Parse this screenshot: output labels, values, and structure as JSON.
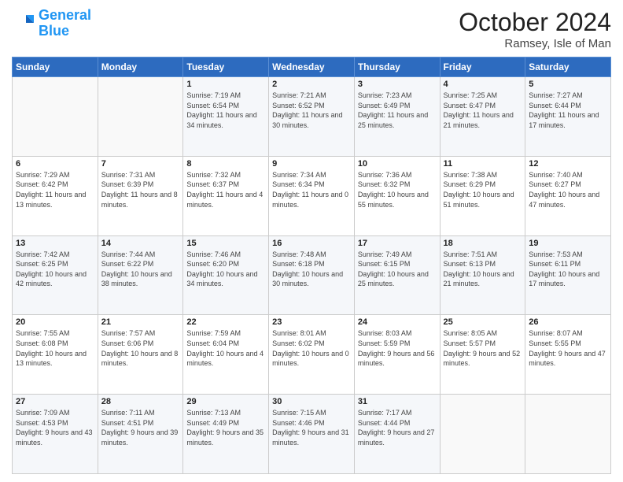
{
  "header": {
    "logo_line1": "General",
    "logo_line2": "Blue",
    "month": "October 2024",
    "location": "Ramsey, Isle of Man"
  },
  "weekdays": [
    "Sunday",
    "Monday",
    "Tuesday",
    "Wednesday",
    "Thursday",
    "Friday",
    "Saturday"
  ],
  "weeks": [
    [
      {
        "day": "",
        "sunrise": "",
        "sunset": "",
        "daylight": ""
      },
      {
        "day": "",
        "sunrise": "",
        "sunset": "",
        "daylight": ""
      },
      {
        "day": "1",
        "sunrise": "Sunrise: 7:19 AM",
        "sunset": "Sunset: 6:54 PM",
        "daylight": "Daylight: 11 hours and 34 minutes."
      },
      {
        "day": "2",
        "sunrise": "Sunrise: 7:21 AM",
        "sunset": "Sunset: 6:52 PM",
        "daylight": "Daylight: 11 hours and 30 minutes."
      },
      {
        "day": "3",
        "sunrise": "Sunrise: 7:23 AM",
        "sunset": "Sunset: 6:49 PM",
        "daylight": "Daylight: 11 hours and 25 minutes."
      },
      {
        "day": "4",
        "sunrise": "Sunrise: 7:25 AM",
        "sunset": "Sunset: 6:47 PM",
        "daylight": "Daylight: 11 hours and 21 minutes."
      },
      {
        "day": "5",
        "sunrise": "Sunrise: 7:27 AM",
        "sunset": "Sunset: 6:44 PM",
        "daylight": "Daylight: 11 hours and 17 minutes."
      }
    ],
    [
      {
        "day": "6",
        "sunrise": "Sunrise: 7:29 AM",
        "sunset": "Sunset: 6:42 PM",
        "daylight": "Daylight: 11 hours and 13 minutes."
      },
      {
        "day": "7",
        "sunrise": "Sunrise: 7:31 AM",
        "sunset": "Sunset: 6:39 PM",
        "daylight": "Daylight: 11 hours and 8 minutes."
      },
      {
        "day": "8",
        "sunrise": "Sunrise: 7:32 AM",
        "sunset": "Sunset: 6:37 PM",
        "daylight": "Daylight: 11 hours and 4 minutes."
      },
      {
        "day": "9",
        "sunrise": "Sunrise: 7:34 AM",
        "sunset": "Sunset: 6:34 PM",
        "daylight": "Daylight: 11 hours and 0 minutes."
      },
      {
        "day": "10",
        "sunrise": "Sunrise: 7:36 AM",
        "sunset": "Sunset: 6:32 PM",
        "daylight": "Daylight: 10 hours and 55 minutes."
      },
      {
        "day": "11",
        "sunrise": "Sunrise: 7:38 AM",
        "sunset": "Sunset: 6:29 PM",
        "daylight": "Daylight: 10 hours and 51 minutes."
      },
      {
        "day": "12",
        "sunrise": "Sunrise: 7:40 AM",
        "sunset": "Sunset: 6:27 PM",
        "daylight": "Daylight: 10 hours and 47 minutes."
      }
    ],
    [
      {
        "day": "13",
        "sunrise": "Sunrise: 7:42 AM",
        "sunset": "Sunset: 6:25 PM",
        "daylight": "Daylight: 10 hours and 42 minutes."
      },
      {
        "day": "14",
        "sunrise": "Sunrise: 7:44 AM",
        "sunset": "Sunset: 6:22 PM",
        "daylight": "Daylight: 10 hours and 38 minutes."
      },
      {
        "day": "15",
        "sunrise": "Sunrise: 7:46 AM",
        "sunset": "Sunset: 6:20 PM",
        "daylight": "Daylight: 10 hours and 34 minutes."
      },
      {
        "day": "16",
        "sunrise": "Sunrise: 7:48 AM",
        "sunset": "Sunset: 6:18 PM",
        "daylight": "Daylight: 10 hours and 30 minutes."
      },
      {
        "day": "17",
        "sunrise": "Sunrise: 7:49 AM",
        "sunset": "Sunset: 6:15 PM",
        "daylight": "Daylight: 10 hours and 25 minutes."
      },
      {
        "day": "18",
        "sunrise": "Sunrise: 7:51 AM",
        "sunset": "Sunset: 6:13 PM",
        "daylight": "Daylight: 10 hours and 21 minutes."
      },
      {
        "day": "19",
        "sunrise": "Sunrise: 7:53 AM",
        "sunset": "Sunset: 6:11 PM",
        "daylight": "Daylight: 10 hours and 17 minutes."
      }
    ],
    [
      {
        "day": "20",
        "sunrise": "Sunrise: 7:55 AM",
        "sunset": "Sunset: 6:08 PM",
        "daylight": "Daylight: 10 hours and 13 minutes."
      },
      {
        "day": "21",
        "sunrise": "Sunrise: 7:57 AM",
        "sunset": "Sunset: 6:06 PM",
        "daylight": "Daylight: 10 hours and 8 minutes."
      },
      {
        "day": "22",
        "sunrise": "Sunrise: 7:59 AM",
        "sunset": "Sunset: 6:04 PM",
        "daylight": "Daylight: 10 hours and 4 minutes."
      },
      {
        "day": "23",
        "sunrise": "Sunrise: 8:01 AM",
        "sunset": "Sunset: 6:02 PM",
        "daylight": "Daylight: 10 hours and 0 minutes."
      },
      {
        "day": "24",
        "sunrise": "Sunrise: 8:03 AM",
        "sunset": "Sunset: 5:59 PM",
        "daylight": "Daylight: 9 hours and 56 minutes."
      },
      {
        "day": "25",
        "sunrise": "Sunrise: 8:05 AM",
        "sunset": "Sunset: 5:57 PM",
        "daylight": "Daylight: 9 hours and 52 minutes."
      },
      {
        "day": "26",
        "sunrise": "Sunrise: 8:07 AM",
        "sunset": "Sunset: 5:55 PM",
        "daylight": "Daylight: 9 hours and 47 minutes."
      }
    ],
    [
      {
        "day": "27",
        "sunrise": "Sunrise: 7:09 AM",
        "sunset": "Sunset: 4:53 PM",
        "daylight": "Daylight: 9 hours and 43 minutes."
      },
      {
        "day": "28",
        "sunrise": "Sunrise: 7:11 AM",
        "sunset": "Sunset: 4:51 PM",
        "daylight": "Daylight: 9 hours and 39 minutes."
      },
      {
        "day": "29",
        "sunrise": "Sunrise: 7:13 AM",
        "sunset": "Sunset: 4:49 PM",
        "daylight": "Daylight: 9 hours and 35 minutes."
      },
      {
        "day": "30",
        "sunrise": "Sunrise: 7:15 AM",
        "sunset": "Sunset: 4:46 PM",
        "daylight": "Daylight: 9 hours and 31 minutes."
      },
      {
        "day": "31",
        "sunrise": "Sunrise: 7:17 AM",
        "sunset": "Sunset: 4:44 PM",
        "daylight": "Daylight: 9 hours and 27 minutes."
      },
      {
        "day": "",
        "sunrise": "",
        "sunset": "",
        "daylight": ""
      },
      {
        "day": "",
        "sunrise": "",
        "sunset": "",
        "daylight": ""
      }
    ]
  ]
}
